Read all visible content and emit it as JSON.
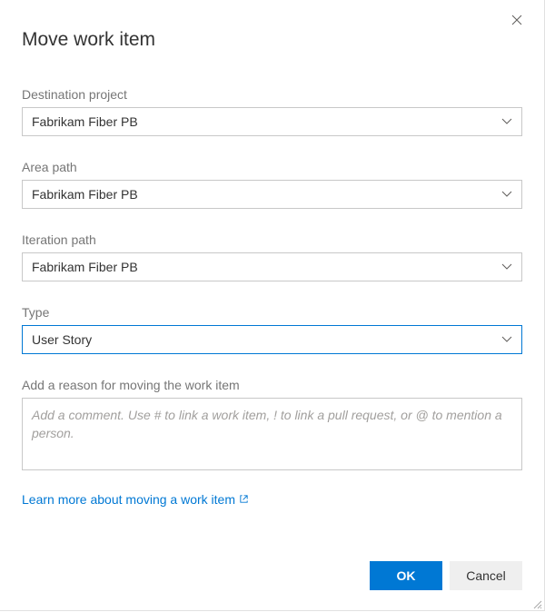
{
  "dialog": {
    "title": "Move work item"
  },
  "fields": {
    "destination": {
      "label": "Destination project",
      "value": "Fabrikam Fiber PB"
    },
    "area": {
      "label": "Area path",
      "value": "Fabrikam Fiber PB"
    },
    "iteration": {
      "label": "Iteration path",
      "value": "Fabrikam Fiber PB"
    },
    "type": {
      "label": "Type",
      "value": "User Story"
    },
    "reason": {
      "label": "Add a reason for moving the work item",
      "placeholder": "Add a comment. Use # to link a work item, ! to link a pull request, or @ to mention a person."
    }
  },
  "link": {
    "text": "Learn more about moving a work item"
  },
  "buttons": {
    "ok": "OK",
    "cancel": "Cancel"
  }
}
